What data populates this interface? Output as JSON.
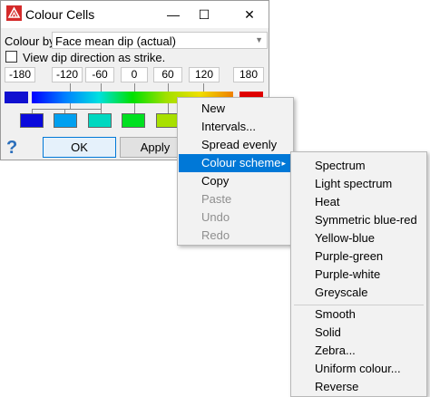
{
  "window": {
    "title": "Colour Cells",
    "minimize": "—",
    "maximize": "☐",
    "close": "✕"
  },
  "colour_by": {
    "label": "Colour by",
    "value": "Face mean dip (actual)"
  },
  "checkbox": {
    "label": "View dip direction as strike.",
    "checked": false
  },
  "ticks": [
    "-180",
    "-120",
    "-60",
    "0",
    "60",
    "120",
    "180"
  ],
  "colours": {
    "blue": "#0a0adc",
    "sky": "#00a0f0",
    "teal": "#00d8c0",
    "green": "#00e020",
    "yellowgreen": "#a8e000",
    "red": "#e00000",
    "accent": "#0078d7"
  },
  "buttons": {
    "help": "?",
    "ok": "OK",
    "apply": "Apply"
  },
  "context_menu": {
    "items": [
      "New",
      "Intervals...",
      "Spread evenly",
      "Colour scheme",
      "Copy",
      "Paste",
      "Undo",
      "Redo"
    ],
    "submenu_arrow": "▸"
  },
  "colour_scheme_menu": {
    "schemes": [
      "Spectrum",
      "Light spectrum",
      "Heat",
      "Symmetric blue-red",
      "Yellow-blue",
      "Purple-green",
      "Purple-white",
      "Greyscale"
    ],
    "options": [
      "Smooth",
      "Solid",
      "Zebra...",
      "Uniform colour...",
      "Reverse"
    ]
  }
}
